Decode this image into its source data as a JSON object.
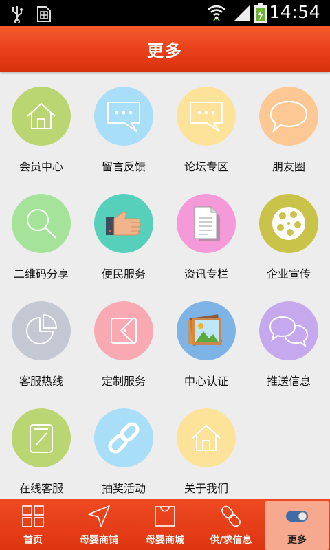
{
  "status_bar": {
    "time": "14:54"
  },
  "header": {
    "title": "更多"
  },
  "grid": {
    "items": [
      {
        "label": "会员中心",
        "icon": "home-icon",
        "color": "#b9d672"
      },
      {
        "label": "留言反馈",
        "icon": "chat-bubble-icon",
        "color": "#a8def8"
      },
      {
        "label": "论坛专区",
        "icon": "chat-bubble-icon",
        "color": "#fde39a"
      },
      {
        "label": "朋友圈",
        "icon": "speech-bubble-icon",
        "color": "#fdc893"
      },
      {
        "label": "二维码分享",
        "icon": "magnifier-icon",
        "color": "#a6e39a"
      },
      {
        "label": "便民服务",
        "icon": "thumbs-up-icon",
        "color": "#56d0bb"
      },
      {
        "label": "资讯专栏",
        "icon": "document-icon",
        "color": "#f59ad9"
      },
      {
        "label": "企业宣传",
        "icon": "film-reel-icon",
        "color": "#c9c34a"
      },
      {
        "label": "客服热线",
        "icon": "pie-chart-icon",
        "color": "#c4c8d3"
      },
      {
        "label": "定制服务",
        "icon": "tag-icon",
        "color": "#f8a9b2"
      },
      {
        "label": "中心认证",
        "icon": "picture-icon",
        "color": "#7eb3e5"
      },
      {
        "label": "推送信息",
        "icon": "double-chat-icon",
        "color": "#c6a8ef"
      },
      {
        "label": "在线客服",
        "icon": "edit-icon",
        "color": "#b9d672"
      },
      {
        "label": "抽奖活动",
        "icon": "link-icon",
        "color": "#a8def8"
      },
      {
        "label": "关于我们",
        "icon": "home-icon",
        "color": "#fde39a"
      }
    ]
  },
  "tab_bar": {
    "tabs": [
      {
        "label": "首页",
        "icon": "grid-icon"
      },
      {
        "label": "母婴商铺",
        "icon": "navigation-icon"
      },
      {
        "label": "母婴商城",
        "icon": "shopping-bag-icon"
      },
      {
        "label": "供/求信息",
        "icon": "link-icon"
      },
      {
        "label": "更多",
        "icon": "toggle-icon",
        "active": true
      }
    ]
  },
  "colors": {
    "accent": "#e8401a",
    "active_tab_bg": "#f7a98f",
    "background": "#ededed"
  }
}
